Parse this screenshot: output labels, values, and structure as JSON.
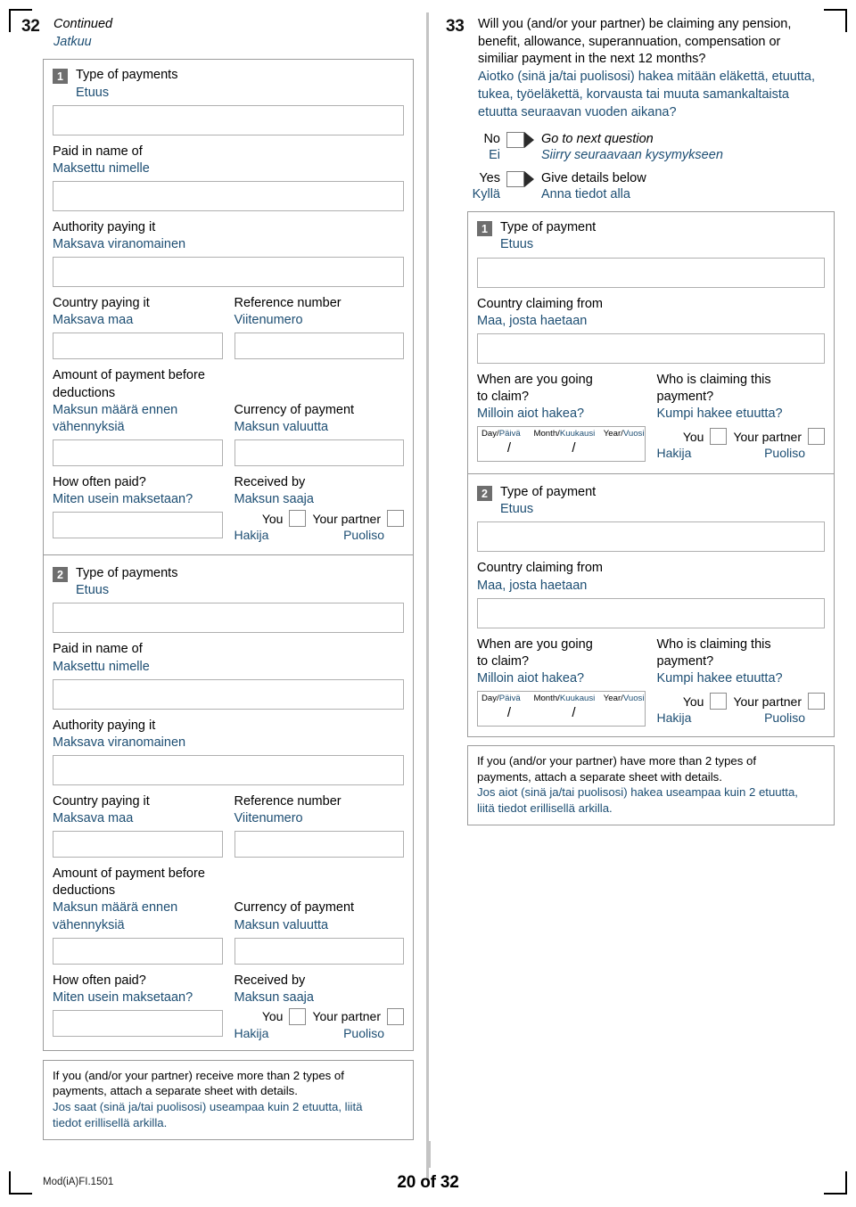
{
  "document": {
    "form_code": "Mod(iA)FI.1501",
    "page_label": "20 of 32"
  },
  "q32": {
    "number": "32",
    "title_en": "Continued",
    "title_fi": "Jatkuu",
    "blocks": [
      {
        "badge": "1",
        "type_en": "Type of payments",
        "type_fi": "Etuus",
        "paid_name_en": "Paid in name of",
        "paid_name_fi": "Maksettu nimelle",
        "authority_en": "Authority paying it",
        "authority_fi": "Maksava viranomainen",
        "country_en": "Country paying it",
        "country_fi": "Maksava maa",
        "reference_en": "Reference number",
        "reference_fi": "Viitenumero",
        "amount_en_1": "Amount of payment before",
        "amount_en_2": "deductions",
        "amount_fi_1": "Maksun määrä ennen",
        "amount_fi_2": "vähennyksiä",
        "currency_en": "Currency of payment",
        "currency_fi": "Maksun valuutta",
        "howoften_en": "How often paid?",
        "howoften_fi": "Miten usein maksetaan?",
        "receivedby_en": "Received by",
        "receivedby_fi": "Maksun saaja",
        "you_en": "You",
        "you_fi": "Hakija",
        "partner_en": "Your partner",
        "partner_fi": "Puoliso"
      },
      {
        "badge": "2",
        "type_en": "Type of payments",
        "type_fi": "Etuus",
        "paid_name_en": "Paid in name of",
        "paid_name_fi": "Maksettu nimelle",
        "authority_en": "Authority paying it",
        "authority_fi": "Maksava viranomainen",
        "country_en": "Country paying it",
        "country_fi": "Maksava maa",
        "reference_en": "Reference number",
        "reference_fi": "Viitenumero",
        "amount_en_1": "Amount of payment before",
        "amount_en_2": "deductions",
        "amount_fi_1": "Maksun määrä ennen",
        "amount_fi_2": "vähennyksiä",
        "currency_en": "Currency of payment",
        "currency_fi": "Maksun valuutta",
        "howoften_en": "How often paid?",
        "howoften_fi": "Miten usein maksetaan?",
        "receivedby_en": "Received by",
        "receivedby_fi": "Maksun saaja",
        "you_en": "You",
        "you_fi": "Hakija",
        "partner_en": "Your partner",
        "partner_fi": "Puoliso"
      }
    ],
    "note_en_1": "If you (and/or your partner) receive more than 2 types of",
    "note_en_2": "payments, attach a separate sheet with details.",
    "note_fi_1": "Jos saat (sinä ja/tai puolisosi) useampaa kuin 2 etuutta, liitä",
    "note_fi_2": "tiedot erillisellä arkilla."
  },
  "q33": {
    "number": "33",
    "question_en_1": "Will you (and/or your partner) be claiming any pension,",
    "question_en_2": "benefit, allowance, superannuation, compensation or",
    "question_en_3": "similiar payment in the next 12 months?",
    "question_fi_1": "Aiotko (sinä ja/tai puolisosi) hakea mitään eläkettä, etuutta,",
    "question_fi_2": "tukea, työeläkettä, korvausta tai muuta samankaltaista",
    "question_fi_3": "etuutta seuraavan vuoden aikana?",
    "no_en": "No",
    "no_fi": "Ei",
    "no_action_en": "Go to next question",
    "no_action_fi": "Siirry seuraavaan kysymykseen",
    "yes_en": "Yes",
    "yes_fi": "Kyllä",
    "yes_action_en": "Give details below",
    "yes_action_fi": "Anna tiedot alla",
    "blocks": [
      {
        "badge": "1",
        "type_en": "Type of payment",
        "type_fi": "Etuus",
        "country_en": "Country claiming from",
        "country_fi": "Maa, josta haetaan",
        "when_en_1": "When are you going",
        "when_en_2": "to claim?",
        "when_fi": "Milloin aiot hakea?",
        "day_en": "Day/",
        "day_fi": "Päivä",
        "month_en": "Month/",
        "month_fi": "Kuukausi",
        "year_en": "Year/",
        "year_fi": "Vuosi",
        "slash": "/",
        "who_en_1": "Who is claiming this",
        "who_en_2": "payment?",
        "who_fi": "Kumpi hakee etuutta?",
        "you_en": "You",
        "you_fi": "Hakija",
        "partner_en": "Your partner",
        "partner_fi": "Puoliso"
      },
      {
        "badge": "2",
        "type_en": "Type of payment",
        "type_fi": "Etuus",
        "country_en": "Country claiming from",
        "country_fi": "Maa, josta haetaan",
        "when_en_1": "When are you going",
        "when_en_2": "to claim?",
        "when_fi": "Milloin aiot hakea?",
        "day_en": "Day/",
        "day_fi": "Päivä",
        "month_en": "Month/",
        "month_fi": "Kuukausi",
        "year_en": "Year/",
        "year_fi": "Vuosi",
        "slash": "/",
        "who_en_1": "Who is claiming this",
        "who_en_2": "payment?",
        "who_fi": "Kumpi hakee etuutta?",
        "you_en": "You",
        "you_fi": "Hakija",
        "partner_en": "Your partner",
        "partner_fi": "Puoliso"
      }
    ],
    "note_en_1": "If you (and/or your partner) have more than 2 types of",
    "note_en_2": "payments, attach a separate sheet with details.",
    "note_fi_1": "Jos aiot (sinä ja/tai puolisosi) hakea useampaa kuin 2 etuutta,",
    "note_fi_2": "liitä tiedot erillisellä arkilla."
  },
  "colors": {
    "finnish_text": "#1d4e73",
    "badge_bg": "#6e6e6e",
    "border": "#9b9b9b"
  }
}
